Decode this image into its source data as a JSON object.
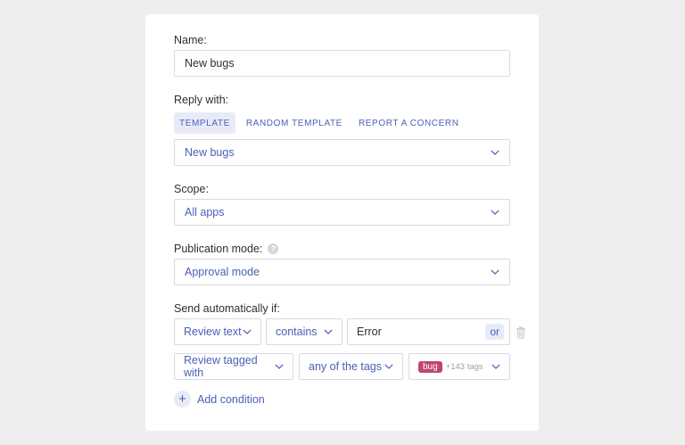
{
  "form": {
    "name_label": "Name:",
    "name_value": "New bugs",
    "reply_label": "Reply with:",
    "reply_tabs": [
      "TEMPLATE",
      "RANDOM TEMPLATE",
      "REPORT A CONCERN"
    ],
    "reply_active_tab": "TEMPLATE",
    "template_value": "New bugs",
    "scope_label": "Scope:",
    "scope_value": "All apps",
    "publication_label": "Publication mode:",
    "publication_value": "Approval mode",
    "send_label": "Send automatically if:",
    "conditions": [
      {
        "field": "Review text",
        "operator": "contains",
        "value": "Error",
        "or_label": "or"
      },
      {
        "field": "Review tagged with",
        "operator": "any of the tags",
        "tag": "bug",
        "more_tags": "+143 tags"
      }
    ],
    "add_condition_label": "Add condition"
  },
  "colors": {
    "accent": "#4a5fb7",
    "accent_bg": "#e8ebf7",
    "tag_bug": "#c0476b",
    "page_bg": "#eeeeee"
  },
  "icons": {
    "dropdown": "chevron-down-icon",
    "help": "question-circle-icon",
    "delete": "trash-icon",
    "add": "plus-icon"
  }
}
